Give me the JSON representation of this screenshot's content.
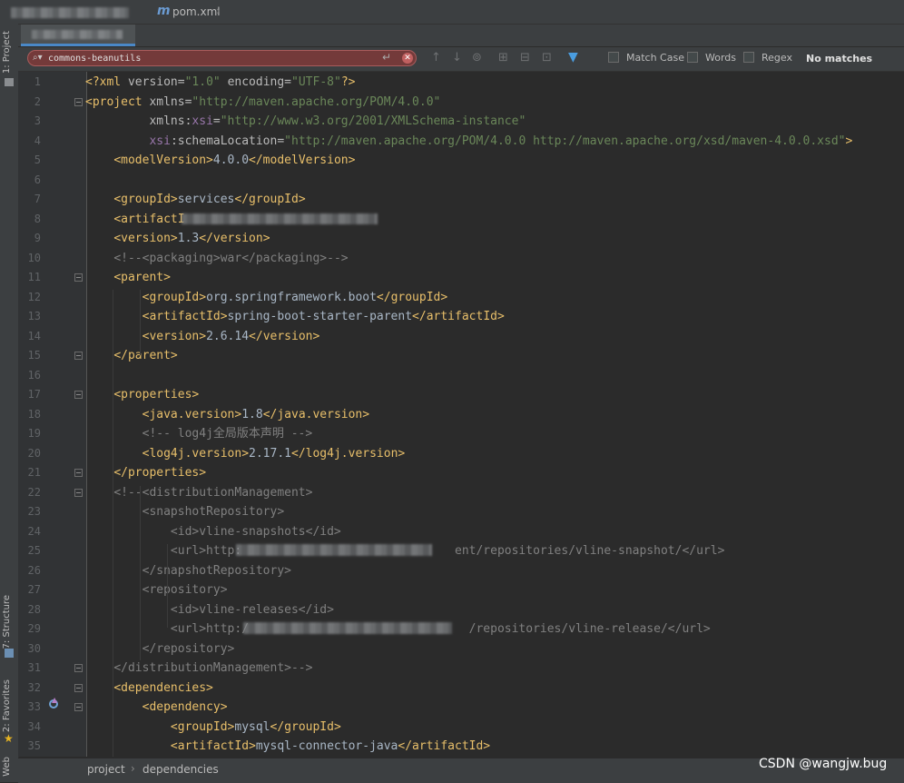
{
  "breadcrumb": {
    "file": "pom.xml",
    "file_icon": "m"
  },
  "search": {
    "query": "commons-beanutils",
    "match_case": "Match Case",
    "words": "Words",
    "regex": "Regex",
    "status": "No matches"
  },
  "tool_windows": {
    "project": "1: Project",
    "structure": "7: Structure",
    "favorites": "2: Favorites",
    "web": "Web"
  },
  "editor": {
    "lines": [
      {
        "n": "1",
        "html": "<span class=\"t\">&lt;?xml </span><span class=\"at\">version=</span><span class=\"av\">\"1.0\"</span> <span class=\"at\">encoding=</span><span class=\"av\">\"UTF-8\"</span><span class=\"t\">?&gt;</span>"
      },
      {
        "n": "2",
        "html": "<span class=\"t\">&lt;project </span><span class=\"at\">xmlns=</span><span class=\"av\">\"http://maven.apache.org/POM/4.0.0\"</span>"
      },
      {
        "n": "3",
        "html": "         <span class=\"at\">xmlns:</span><span class=\"ns\">xsi</span><span class=\"at\">=</span><span class=\"av\">\"http://www.w3.org/2001/XMLSchema-instance\"</span>"
      },
      {
        "n": "4",
        "html": "         <span class=\"ns\">xsi</span><span class=\"at\">:schemaLocation=</span><span class=\"av\">\"http://maven.apache.org/POM/4.0.0 http://maven.apache.org/xsd/maven-4.0.0.xsd\"</span><span class=\"t\">&gt;</span>"
      },
      {
        "n": "5",
        "html": "    <span class=\"t\">&lt;modelVersion&gt;</span>4.0.0<span class=\"t\">&lt;/modelVersion&gt;</span>"
      },
      {
        "n": "6",
        "html": ""
      },
      {
        "n": "7",
        "html": "    <span class=\"t\">&lt;groupId&gt;</span>services<span class=\"t\">&lt;/groupId&gt;</span>"
      },
      {
        "n": "8",
        "html": "    <span class=\"t\">&lt;artifactI</span>"
      },
      {
        "n": "9",
        "html": "    <span class=\"t\">&lt;version&gt;</span>1.3<span class=\"t\">&lt;/version&gt;</span>"
      },
      {
        "n": "10",
        "html": "    <span class=\"cm\">&lt;!--&lt;packaging&gt;war&lt;/packaging&gt;--&gt;</span>"
      },
      {
        "n": "11",
        "html": "    <span class=\"t\">&lt;parent&gt;</span>"
      },
      {
        "n": "12",
        "html": "        <span class=\"t\">&lt;groupId&gt;</span>org.springframework.boot<span class=\"t\">&lt;/groupId&gt;</span>"
      },
      {
        "n": "13",
        "html": "        <span class=\"t\">&lt;artifactId&gt;</span>spring-boot-starter-parent<span class=\"t\">&lt;/artifactId&gt;</span>"
      },
      {
        "n": "14",
        "html": "        <span class=\"t\">&lt;version&gt;</span>2.6.14<span class=\"t\">&lt;/version&gt;</span>"
      },
      {
        "n": "15",
        "html": "    <span class=\"t\">&lt;/parent&gt;</span>"
      },
      {
        "n": "16",
        "html": ""
      },
      {
        "n": "17",
        "html": "    <span class=\"t\">&lt;properties&gt;</span>"
      },
      {
        "n": "18",
        "html": "        <span class=\"t\">&lt;java.version&gt;</span>1.8<span class=\"t\">&lt;/java.version&gt;</span>"
      },
      {
        "n": "19",
        "html": "        <span class=\"cm\">&lt;!-- log4j全局版本声明 --&gt;</span>"
      },
      {
        "n": "20",
        "html": "        <span class=\"t\">&lt;log4j.version&gt;</span>2.17.1<span class=\"t\">&lt;/log4j.version&gt;</span>"
      },
      {
        "n": "21",
        "html": "    <span class=\"t\">&lt;/properties&gt;</span>"
      },
      {
        "n": "22",
        "html": "    <span class=\"cm\">&lt;!--&lt;distributionManagement&gt;</span>"
      },
      {
        "n": "23",
        "html": "        <span class=\"cm\">&lt;snapshotRepository&gt;</span>"
      },
      {
        "n": "24",
        "html": "            <span class=\"cm\">&lt;id&gt;vline-snapshots&lt;/id&gt;</span>"
      },
      {
        "n": "25",
        "html": "            <span class=\"cm\">&lt;url&gt;http:                              ent/repositories/vline-snapshot/&lt;/url&gt;</span>"
      },
      {
        "n": "26",
        "html": "        <span class=\"cm\">&lt;/snapshotRepository&gt;</span>"
      },
      {
        "n": "27",
        "html": "        <span class=\"cm\">&lt;repository&gt;</span>"
      },
      {
        "n": "28",
        "html": "            <span class=\"cm\">&lt;id&gt;vline-releases&lt;/id&gt;</span>"
      },
      {
        "n": "29",
        "html": "            <span class=\"cm\">&lt;url&gt;http:/                               /repositories/vline-release/&lt;/url&gt;</span>"
      },
      {
        "n": "30",
        "html": "        <span class=\"cm\">&lt;/repository&gt;</span>"
      },
      {
        "n": "31",
        "html": "    <span class=\"cm\">&lt;/distributionManagement&gt;--&gt;</span>"
      },
      {
        "n": "32",
        "html": "    <span class=\"t\">&lt;dependencies&gt;</span>"
      },
      {
        "n": "33",
        "html": "        <span class=\"t\">&lt;dependency&gt;</span>"
      },
      {
        "n": "34",
        "html": "            <span class=\"t\">&lt;groupId&gt;</span>mysql<span class=\"t\">&lt;/groupId&gt;</span>"
      },
      {
        "n": "35",
        "html": "            <span class=\"t\">&lt;artifactId&gt;</span>mysql-connector-java<span class=\"t\">&lt;/artifactId&gt;</span>"
      }
    ]
  },
  "status_breadcrumb": {
    "first": "project",
    "second": "dependencies"
  },
  "watermark": "CSDN @wangjw.bug"
}
